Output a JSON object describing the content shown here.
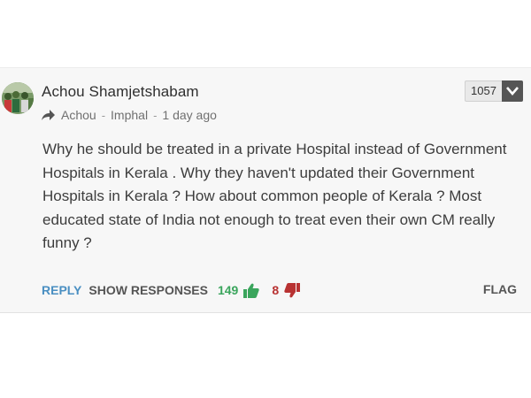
{
  "comment": {
    "author": "Achou Shamjetshabam",
    "reply_to": "Achou",
    "location": "Imphal",
    "timestamp": "1 day ago",
    "separator": "-",
    "score": "1057",
    "text": "Why he should be treated in a private Hospital instead of Government Hospitals in Kerala . Why they haven't updated their Government Hospitals in Kerala ? How about common people of Kerala ? Most educated state of India not enough to treat even their own CM really funny ?",
    "actions": {
      "reply_label": "REPLY",
      "show_responses_label": "SHOW RESPONSES",
      "upvotes": "149",
      "downvotes": "8",
      "flag_label": "FLAG"
    }
  },
  "colors": {
    "reply": "#4a8fc2",
    "upvote": "#3aa55c",
    "downvote": "#b83232",
    "card_bg": "#f7f7f7"
  },
  "icons": [
    "avatar",
    "reply-arrow-icon",
    "chevron-down-icon",
    "thumbs-up-icon",
    "thumbs-down-icon"
  ]
}
